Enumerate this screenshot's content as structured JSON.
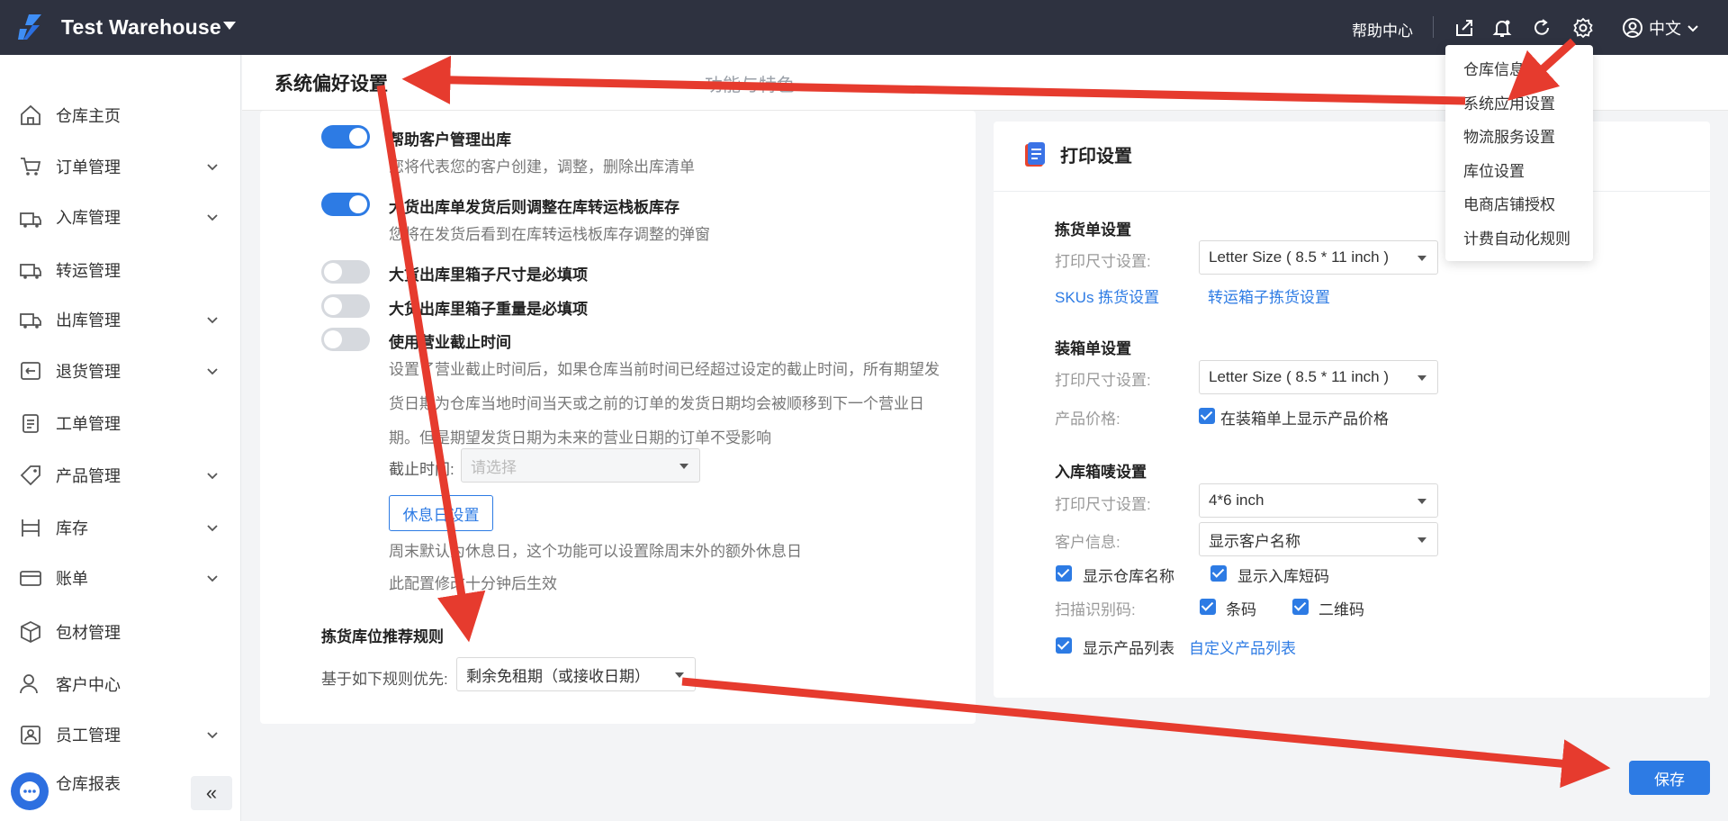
{
  "header": {
    "brand": "Test Warehouse",
    "help": "帮助中心",
    "language": "中文",
    "icons": [
      "export-icon",
      "bell-icon",
      "refresh-icon",
      "gear-icon",
      "user-icon"
    ]
  },
  "sidebar": {
    "items": [
      {
        "label": "仓库主页",
        "icon": "home-icon",
        "expandable": false
      },
      {
        "label": "订单管理",
        "icon": "cart-icon",
        "expandable": true
      },
      {
        "label": "入库管理",
        "icon": "inbound-icon",
        "expandable": true
      },
      {
        "label": "转运管理",
        "icon": "transfer-icon",
        "expandable": false
      },
      {
        "label": "出库管理",
        "icon": "truck-icon",
        "expandable": true
      },
      {
        "label": "退货管理",
        "icon": "return-icon",
        "expandable": true
      },
      {
        "label": "工单管理",
        "icon": "clipboard-icon",
        "expandable": false
      },
      {
        "label": "产品管理",
        "icon": "tag-icon",
        "expandable": true
      },
      {
        "label": "库存",
        "icon": "shelf-icon",
        "expandable": true
      },
      {
        "label": "账单",
        "icon": "card-icon",
        "expandable": true
      },
      {
        "label": "包材管理",
        "icon": "box-icon",
        "expandable": false
      },
      {
        "label": "客户中心",
        "icon": "customer-icon",
        "expandable": false
      },
      {
        "label": "员工管理",
        "icon": "staff-icon",
        "expandable": true
      },
      {
        "label": "仓库报表",
        "icon": "report-icon",
        "expandable": true
      }
    ],
    "collapse": "«"
  },
  "tabs": {
    "active": "系统偏好设置",
    "other": "功能与特色"
  },
  "preferences": {
    "options": [
      {
        "title": "帮助客户管理出库",
        "desc": "您将代表您的客户创建，调整，删除出库清单",
        "on": true
      },
      {
        "title": "大货出库单发货后则调整在库转运栈板库存",
        "desc": "您将在发货后看到在库转运栈板库存调整的弹窗",
        "on": true
      },
      {
        "title": "大货出库里箱子尺寸是必填项",
        "desc": "",
        "on": false
      },
      {
        "title": "大货出库里箱子重量是必填项",
        "desc": "",
        "on": false
      },
      {
        "title": "使用营业截止时间",
        "desc": "",
        "on": false
      }
    ],
    "cutoff_desc": "设置了营业截止时间后，如果仓库当前时间已经超过设定的截止时间，所有期望发货日期为仓库当地时间当天或之前的订单的发货日期均会被顺移到下一个营业日期。但是期望发货日期为未来的营业日期的订单不受影响",
    "cutoff_label": "截止时间:",
    "cutoff_placeholder": "请选择",
    "holiday_button": "休息日设置",
    "holiday_desc1": "周末默认为休息日，这个功能可以设置除周末外的额外休息日",
    "holiday_desc2": "此配置修改十分钟后生效",
    "picking_rule_title": "拣货库位推荐规则",
    "picking_rule_label": "基于如下规则优先:",
    "picking_rule_value": "剩余免租期（或接收日期）"
  },
  "print": {
    "title": "打印设置",
    "pick_title": "拣货单设置",
    "pick_size_label": "打印尺寸设置:",
    "pick_size_value": "Letter Size ( 8.5 * 11 inch )",
    "sku_link": "SKUs 拣货设置",
    "box_link": "转运箱子拣货设置",
    "pack_title": "装箱单设置",
    "pack_size_label": "打印尺寸设置:",
    "pack_size_value": "Letter Size ( 8.5 * 11 inch )",
    "price_label": "产品价格:",
    "price_cb": "在装箱单上显示产品价格",
    "mark_title": "入库箱唛设置",
    "mark_size_label": "打印尺寸设置:",
    "mark_size_value": "4*6 inch",
    "customer_label": "客户信息:",
    "customer_value": "显示客户名称",
    "show_warehouse": "显示仓库名称",
    "show_code": "显示入库短码",
    "scan_label": "扫描识别码:",
    "barcode": "条码",
    "qrcode": "二维码",
    "show_products": "显示产品列表",
    "custom_list_link": "自定义产品列表"
  },
  "settings_menu": {
    "items": [
      "仓库信息",
      "系统应用设置",
      "物流服务设置",
      "库位设置",
      "电商店铺授权",
      "计费自动化规则"
    ]
  },
  "save_button": "保存",
  "colors": {
    "primary": "#2d7be4",
    "topbar": "#2e3240",
    "annotation": "#e63b2e"
  }
}
